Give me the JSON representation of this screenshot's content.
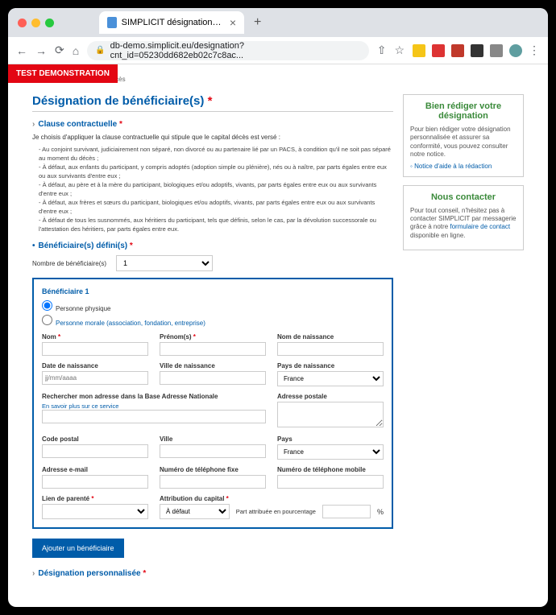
{
  "browser": {
    "tab_title": "SIMPLICIT désignation de bén",
    "url": "db-demo.simplicit.eu/designation?cnt_id=05230dd682eb02c7c8ac..."
  },
  "badge": "TEST DEMONSTRATION",
  "breadcrumb": "Réédite à mon décès",
  "title": "Désignation de bénéficiaire(s)",
  "section_clause": "Clause contractuelle",
  "intro": "Je choisis d'appliquer la clause contractuelle qui stipule que le capital décès est versé :",
  "bullets": [
    "- Au conjoint survivant, judiciairement non séparé, non divorcé ou au partenaire lié par un PACS, à condition qu'il ne soit pas séparé au moment du décès ;",
    "- À défaut, aux enfants du participant, y compris adoptés (adoption simple ou plénière), nés ou à naître, par parts égales entre eux ou aux survivants d'entre eux ;",
    "- À défaut, au père et à la mère du participant, biologiques et/ou adoptifs, vivants, par parts égales entre eux ou aux survivants d'entre eux ;",
    "- À défaut, aux frères et sœurs du participant, biologiques et/ou adoptifs, vivants, par parts égales entre eux ou aux survivants d'entre eux ;",
    "- À défaut de tous les susnommés, aux héritiers du participant, tels que définis, selon le cas, par la dévolution successorale ou l'attestation des héritiers, par parts égales entre eux."
  ],
  "section_benef": "Bénéficiaire(s) défini(s)",
  "count_label": "Nombre de bénéficiaire(s)",
  "count_value": "1",
  "benef": {
    "title": "Bénéficiaire 1",
    "radio_phys": "Personne physique",
    "radio_morale": "Personne morale (association, fondation, entreprise)",
    "nom": "Nom",
    "prenom": "Prénom(s)",
    "nom_naissance": "Nom de naissance",
    "date_naissance": "Date de naissance",
    "date_hint": "jj/mm/aaaa",
    "ville_naissance": "Ville de naissance",
    "pays_naissance": "Pays de naissance",
    "pays_value": "France",
    "addr_search": "Rechercher mon adresse dans la Base Adresse Nationale",
    "addr_link": "En savoir plus sur ce service",
    "addr_postale": "Adresse postale",
    "cp": "Code postal",
    "ville": "Ville",
    "pays": "Pays",
    "email": "Adresse e-mail",
    "tel_fixe": "Numéro de téléphone fixe",
    "tel_mobile": "Numéro de téléphone mobile",
    "lien": "Lien de parenté",
    "attrib": "Attribution du capital",
    "attrib_opt": "À défaut",
    "part_label": "Part attribuée en pourcentage",
    "pct": "%"
  },
  "btn_add": "Ajouter un bénéficiaire",
  "section_perso": "Désignation personnalisée",
  "side1": {
    "title": "Bien rédiger votre désignation",
    "text": "Pour bien rédiger votre désignation personnalisée et assurer sa conformité, vous pouvez consulter notre notice.",
    "link": "Notice d'aide à la rédaction"
  },
  "side2": {
    "title": "Nous contacter",
    "text1": "Pour tout conseil, n'hésitez pas à contacter SIMPLICIT par messagerie grâce à notre",
    "link": "formulaire de contact",
    "text2": "disponible en ligne."
  }
}
